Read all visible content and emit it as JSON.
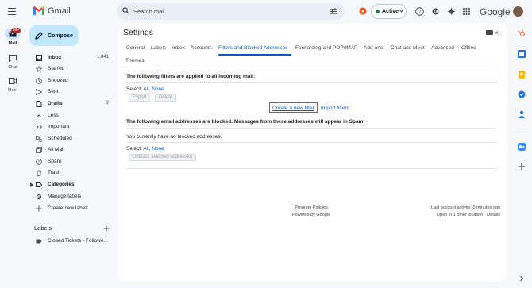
{
  "header": {
    "brand": "Gmail",
    "search_placeholder": "Search mail",
    "status_label": "Active",
    "google_word": "Google"
  },
  "rail": {
    "items": [
      {
        "label": "Mail",
        "icon": "mail-icon"
      },
      {
        "label": "Chat",
        "icon": "chat-icon"
      },
      {
        "label": "Meet",
        "icon": "meet-icon"
      }
    ],
    "badge": "99+"
  },
  "sidebar": {
    "compose": "Compose",
    "items": [
      {
        "label": "Inbox",
        "count": "1,841",
        "icon": "inbox-icon",
        "bold": true
      },
      {
        "label": "Starred",
        "count": "",
        "icon": "star-icon",
        "bold": false
      },
      {
        "label": "Snoozed",
        "count": "",
        "icon": "clock-icon",
        "bold": false
      },
      {
        "label": "Sent",
        "count": "",
        "icon": "send-icon",
        "bold": false
      },
      {
        "label": "Drafts",
        "count": "2",
        "icon": "draft-icon",
        "bold": true
      },
      {
        "label": "Less",
        "count": "",
        "icon": "chevron-up-icon",
        "bold": false
      },
      {
        "label": "Important",
        "count": "",
        "icon": "important-icon",
        "bold": false
      },
      {
        "label": "Scheduled",
        "count": "",
        "icon": "scheduled-icon",
        "bold": false
      },
      {
        "label": "All Mail",
        "count": "",
        "icon": "all-mail-icon",
        "bold": false
      },
      {
        "label": "Spam",
        "count": "",
        "icon": "spam-icon",
        "bold": false
      },
      {
        "label": "Trash",
        "count": "",
        "icon": "trash-icon",
        "bold": false
      },
      {
        "label": "Categories",
        "count": "",
        "icon": "label-icon",
        "bold": true
      },
      {
        "label": "Manage labels",
        "count": "",
        "icon": "gear-icon",
        "bold": false
      },
      {
        "label": "Create new label",
        "count": "",
        "icon": "plus-icon",
        "bold": false
      }
    ],
    "labels_header": "Labels",
    "label_items": [
      {
        "label": "Closed Tickets - Followe..."
      }
    ]
  },
  "settings": {
    "title": "Settings",
    "tabs": [
      {
        "label": "General",
        "active": false
      },
      {
        "label": "Labels",
        "active": false
      },
      {
        "label": "Inbox",
        "active": false
      },
      {
        "label": "Accounts",
        "active": false
      },
      {
        "label": "Filters and Blocked Addresses",
        "active": true
      },
      {
        "label": "Forwarding and POP/IMAP",
        "active": false
      },
      {
        "label": "Add-ons",
        "active": false
      },
      {
        "label": "Chat and Meet",
        "active": false
      },
      {
        "label": "Advanced",
        "active": false
      },
      {
        "label": "Offline",
        "active": false
      },
      {
        "label": "Themes",
        "active": false
      }
    ],
    "filters_heading": "The following filters are applied to all incoming mail:",
    "select_label": "Select:",
    "select_all": "All",
    "select_none": "None",
    "export_btn": "Export",
    "delete_btn": "Delete",
    "create_filter": "Create a new filter",
    "import_filters": "Import filters",
    "blocked_heading": "The following email addresses are blocked. Messages from these addresses will appear in Spam:",
    "no_blocked": "You currently have no blocked addresses.",
    "unblock_btn": "Unblock selected addresses"
  },
  "footer": {
    "program_policies": "Program Policies",
    "powered_by": "Powered by Google",
    "last_activity": "Last account activity: 0 minutes ago",
    "other_location": "Open in 1 other location · Details"
  },
  "colors": {
    "accent": "#0b57d0",
    "compose_bg": "#c2e7ff",
    "highlight_box": "#e53935",
    "badge": "#b3261e"
  }
}
